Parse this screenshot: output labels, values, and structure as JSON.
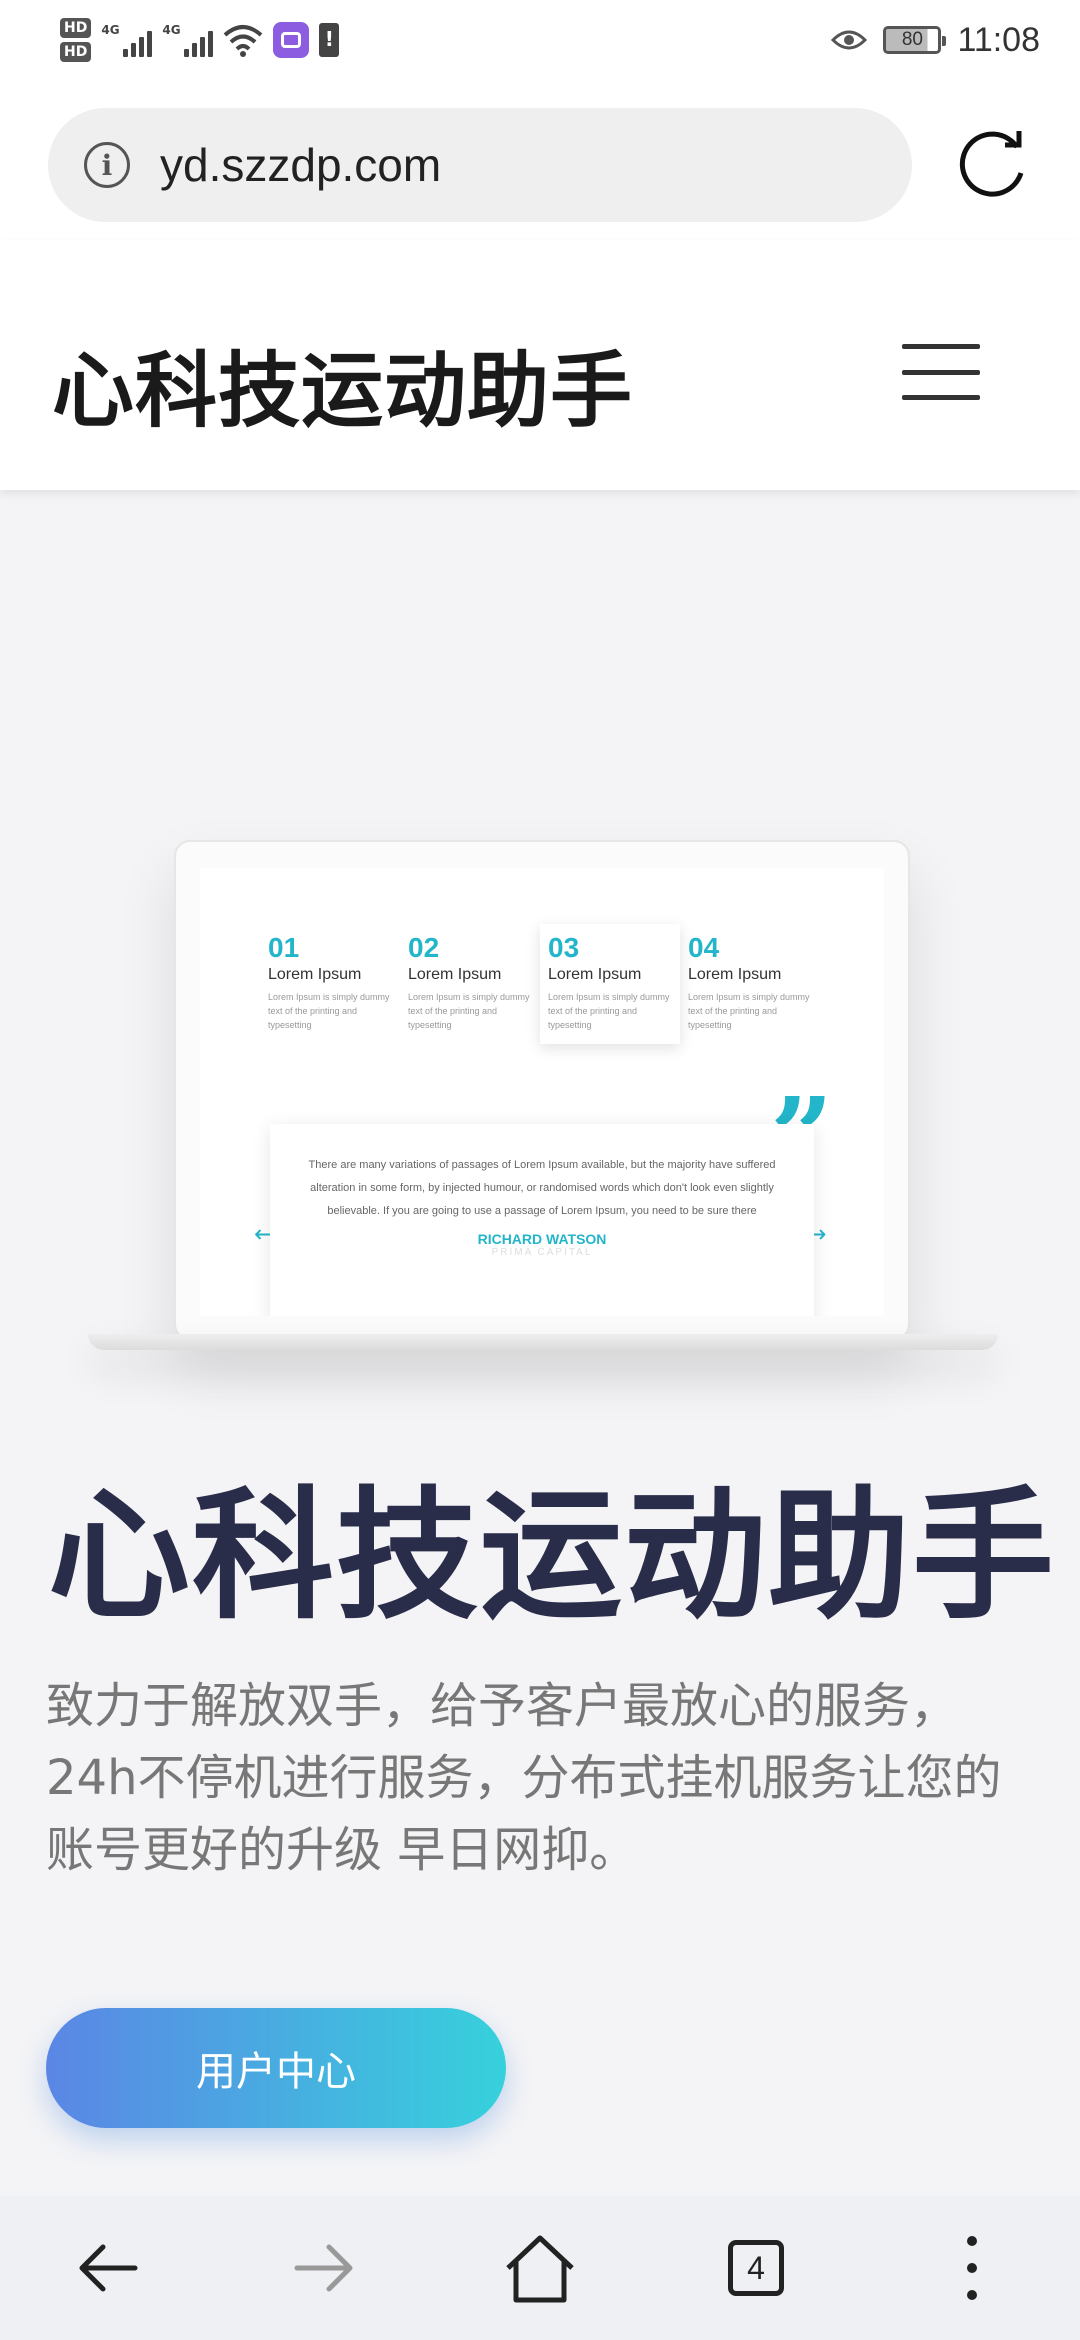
{
  "status_bar": {
    "hd_top": "HD",
    "hd_bottom": "HD",
    "sig1_tag": "4G",
    "sig2_tag": "4G",
    "battery_level": "80",
    "time": "11:08"
  },
  "url_bar": {
    "url": "yd.szzdp.com"
  },
  "site_header": {
    "title": "心科技运动助手"
  },
  "hero": {
    "mockup": {
      "features": [
        {
          "num": "01",
          "title": "Lorem Ipsum",
          "desc": "Lorem Ipsum is simply dummy text of the printing and typesetting"
        },
        {
          "num": "02",
          "title": "Lorem Ipsum",
          "desc": "Lorem Ipsum is simply dummy text of the printing and typesetting"
        },
        {
          "num": "03",
          "title": "Lorem Ipsum",
          "desc": "Lorem Ipsum is simply dummy text of the printing and typesetting"
        },
        {
          "num": "04",
          "title": "Lorem Ipsum",
          "desc": "Lorem Ipsum is simply dummy text of the printing and typesetting"
        }
      ],
      "testimonial_quote": "There are many variations of passages of Lorem Ipsum available, but the majority have suffered alteration in some form, by injected humour, or randomised words which don't look even slightly believable. If you are going to use a passage of Lorem Ipsum, you need to be sure there",
      "testimonial_name": "RICHARD WATSON",
      "testimonial_company": "PRIMA CAPITAL"
    },
    "title": "心科技运动助手",
    "description": "致力于解放双手，给予客户最放心的服务，24h不停机进行服务，分布式挂机服务让您的账号更好的升级 早日网抑。",
    "cta_label": "用户中心"
  },
  "bottom_nav": {
    "tab_count": "4"
  },
  "colors": {
    "accent": "#23b5c9",
    "hero_title": "#2a2d4a",
    "cta_start": "#5b86e5",
    "cta_end": "#36d1dc"
  },
  "icons": [
    "info-icon",
    "reload-icon",
    "menu-icon",
    "back-arrow-icon",
    "forward-arrow-icon",
    "home-icon",
    "tabs-icon",
    "more-icon",
    "eye-icon",
    "battery-icon",
    "wifi-icon",
    "signal-icon"
  ]
}
